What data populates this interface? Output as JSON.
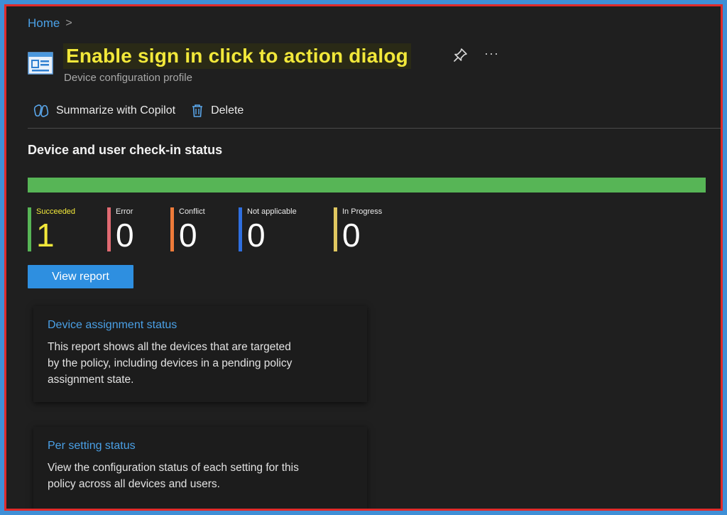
{
  "breadcrumb": {
    "home": "Home",
    "separator": ">"
  },
  "header": {
    "title": "Enable sign in click to action dialog",
    "subtitle": "Device configuration profile",
    "title_highlight_color": "#f2e83a",
    "pin_icon": "pin-icon",
    "more_label": "···"
  },
  "toolbar": {
    "copilot_label": "Summarize with Copilot",
    "delete_label": "Delete"
  },
  "checkin": {
    "title": "Device and user check-in status",
    "progress_percent": 100,
    "progress_color": "#57b556",
    "stats": [
      {
        "label": "Succeeded",
        "value": "1",
        "color": "#57b556"
      },
      {
        "label": "Error",
        "value": "0",
        "color": "#e06a72"
      },
      {
        "label": "Conflict",
        "value": "0",
        "color": "#ee7b3a"
      },
      {
        "label": "Not applicable",
        "value": "0",
        "color": "#2f6fe0"
      },
      {
        "label": "In Progress",
        "value": "0",
        "color": "#e0c760"
      }
    ],
    "view_report_label": "View report"
  },
  "cards": [
    {
      "title": "Device assignment status",
      "desc": "This report shows all the devices that are targeted by the policy, including devices in a pending policy assignment state."
    },
    {
      "title": "Per setting status",
      "desc": "View the configuration status of each setting for this policy across all devices and users."
    }
  ]
}
